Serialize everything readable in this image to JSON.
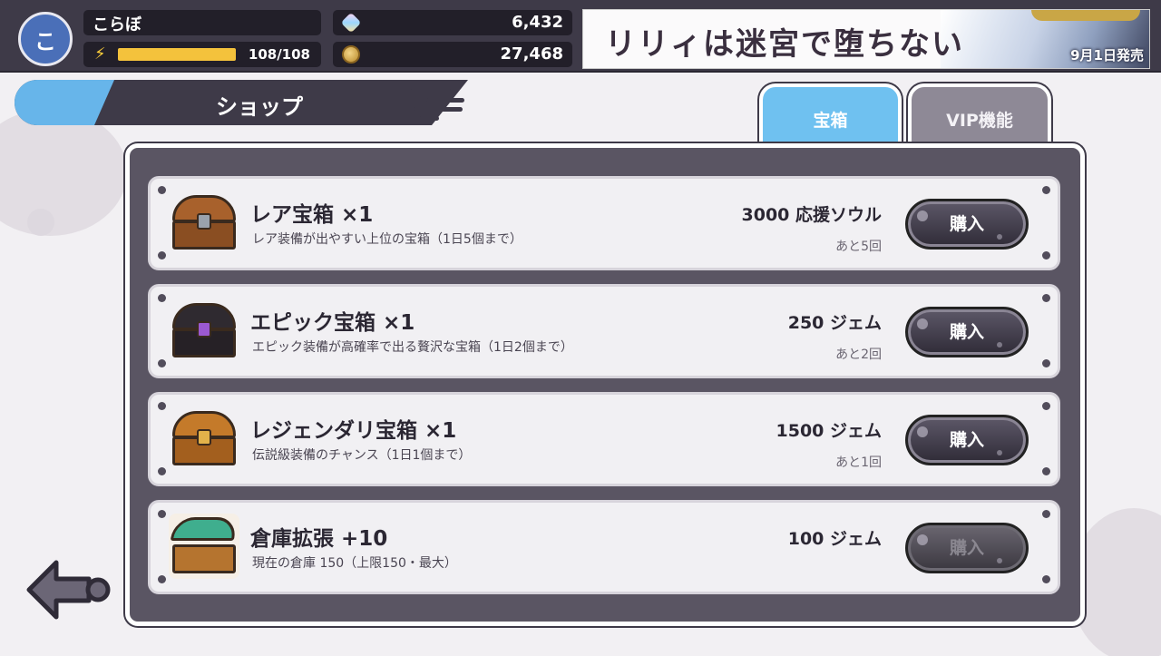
{
  "player": {
    "avatar_initial": "こ",
    "name": "こらぼ",
    "stamina": "108/108",
    "stamina_fill": 1.0,
    "gems": "6,432",
    "gold": "27,468"
  },
  "banner": {
    "title": "リリィは迷宮で堕ちない",
    "release": "9月1日発売"
  },
  "header": {
    "title": "ショップ"
  },
  "tabs": [
    {
      "label": "宝箱",
      "active": true
    },
    {
      "label": "VIP機能",
      "active": false
    }
  ],
  "items": [
    {
      "title": "レア宝箱 ×1",
      "desc": "レア装備が出やすい上位の宝箱（1日5個まで）",
      "price": "3000 応援ソウル",
      "remaining": "あと5回",
      "button": "購入",
      "enabled": true,
      "icon": "rare-chest-icon"
    },
    {
      "title": "エピック宝箱 ×1",
      "desc": "エピック装備が高確率で出る贅沢な宝箱（1日2個まで）",
      "price": "250 ジェム",
      "remaining": "あと2回",
      "button": "購入",
      "enabled": true,
      "icon": "epic-chest-icon"
    },
    {
      "title": "レジェンダリ宝箱 ×1",
      "desc": "伝説級装備のチャンス（1日1個まで）",
      "price": "1500 ジェム",
      "remaining": "あと1回",
      "button": "購入",
      "enabled": true,
      "icon": "legendary-chest-icon"
    },
    {
      "title": "倉庫拡張 +10",
      "desc": "現在の倉庫 150（上限150・最大）",
      "price": "100 ジェム",
      "remaining": "",
      "button": "購入",
      "enabled": false,
      "icon": "storage-chest-icon"
    }
  ],
  "colors": {
    "accent": "#67b5ea",
    "panel": "#5a5563",
    "dark": "#3e3a48"
  }
}
